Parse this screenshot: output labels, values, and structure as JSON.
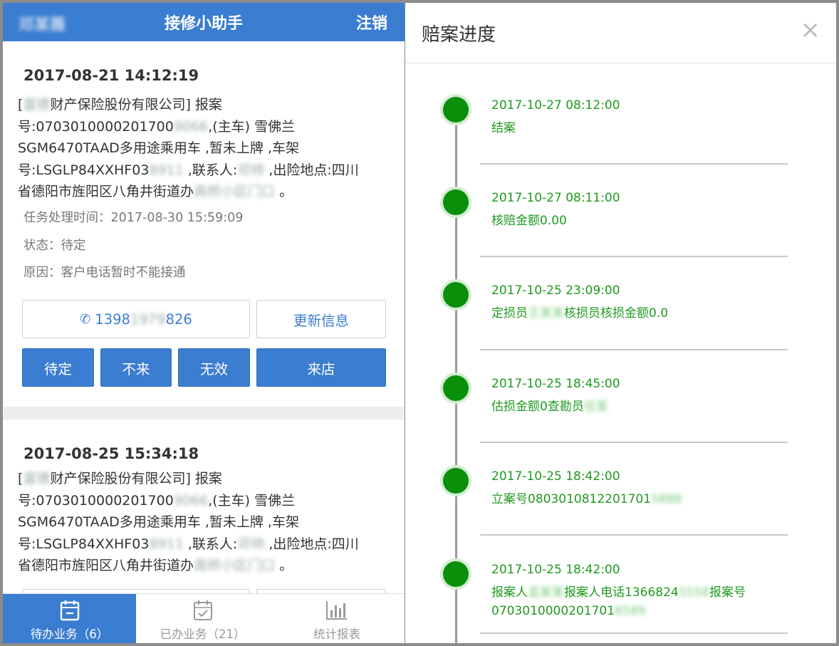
{
  "app": {
    "header": {
      "user": "邓某薇",
      "title": "接修小助手",
      "logout": "注销"
    },
    "cards": [
      {
        "time": "2017-08-21 14:12:19",
        "desc": {
          "l1a": "[",
          "l1b": "富德",
          "l1c": "财产保险股份有限公司] 报案",
          "l2a": "号:0703010000201700",
          "l2b": "9066",
          "l2c": ",(主车) 雪佛兰",
          "l3": "SGM6470TAAD多用途乘用车 ,暂未上牌 ,车架",
          "l4a": "号:LSGLP84XXHF03",
          "l4b": "8911",
          "l4c": " ,联系人:",
          "l4d": "邓帅",
          "l4e": " ,出险地点:四川",
          "l5a": "省德阳市旌阳区八角井街道办",
          "l5b": "高桥小区门口",
          "l5c": " 。"
        },
        "task_time": "任务处理时间：2017-08-30 15:59:09",
        "status": "状态：待定",
        "reason": "原因：客户电话暂时不能接通",
        "phone": {
          "a": "1398",
          "b": "1979",
          "c": "826"
        },
        "update_label": "更新信息",
        "actions": [
          "待定",
          "不来",
          "无效",
          "来店"
        ]
      },
      {
        "time": "2017-08-25 15:34:18",
        "desc": {
          "l1a": "[",
          "l1b": "富德",
          "l1c": "财产保险股份有限公司] 报案",
          "l2a": "号:0703010000201700",
          "l2b": "9066",
          "l2c": ",(主车) 雪佛兰",
          "l3": "SGM6470TAAD多用途乘用车 ,暂未上牌 ,车架",
          "l4a": "号:LSGLP84XXHF03",
          "l4b": "8911",
          "l4c": " ,联系人:",
          "l4d": "邓帅",
          "l4e": " ,出险地点:四川",
          "l5a": "省德阳市旌阳区八角井街道办",
          "l5b": "高桥小区门口",
          "l5c": " 。"
        }
      }
    ],
    "tabs": [
      {
        "label": "待办业务（6）",
        "icon": "calendar-minus-icon",
        "active": true
      },
      {
        "label": "已办业务（21）",
        "icon": "calendar-check-icon",
        "active": false
      },
      {
        "label": "统计报表",
        "icon": "bar-chart-icon",
        "active": false
      }
    ]
  },
  "dialog": {
    "title": "赔案进度",
    "close": "×",
    "items": [
      {
        "time": "2017-10-27 08:12:00",
        "text_a": "结案",
        "text_b": "",
        "text_c": ""
      },
      {
        "time": "2017-10-27 08:11:00",
        "text_a": "核赔金额0.00",
        "text_b": "",
        "text_c": ""
      },
      {
        "time": "2017-10-25 23:09:00",
        "text_a": "定损员",
        "text_b": "王某某",
        "text_c": "核损员核损金额0.0"
      },
      {
        "time": "2017-10-25 18:45:00",
        "text_a": "估损金额0查勘员",
        "text_b": "任某",
        "text_c": ""
      },
      {
        "time": "2017-10-25 18:42:00",
        "text_a": "立案号0803010812201701",
        "text_b": "5888",
        "text_c": ""
      },
      {
        "time": "2017-10-25 18:42:00",
        "text_a": "报案人",
        "text_b": "孟某某",
        "text_c": "报案人电话1366824",
        "text_d": "5558",
        "text_e": "报案号",
        "text_f": "0703010000201701",
        "text_g": "6589"
      }
    ]
  },
  "colors": {
    "primary": "#3b7dd0",
    "timeline_green": "#0a8f0a",
    "timeline_text": "#1f9a1f"
  }
}
